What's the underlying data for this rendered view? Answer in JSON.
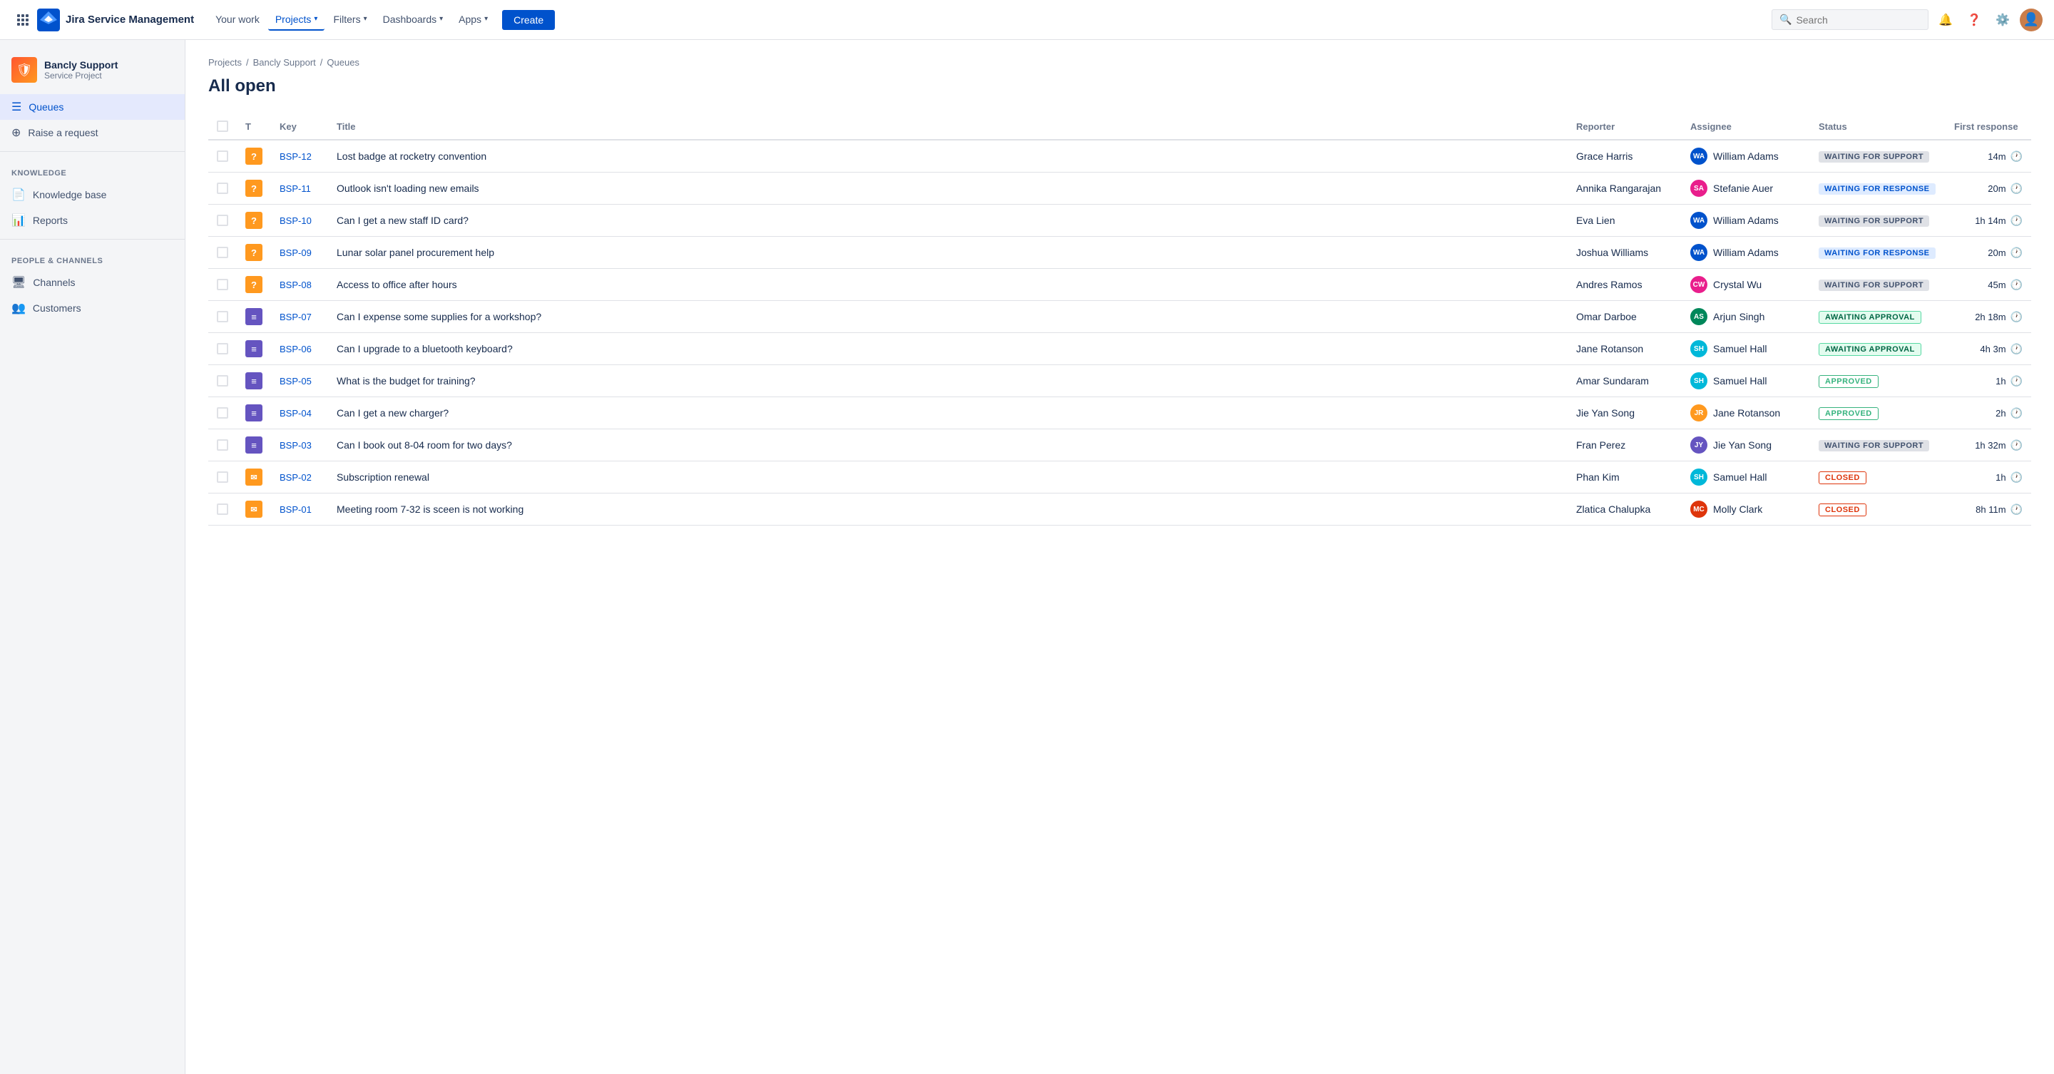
{
  "nav": {
    "logo_text": "Jira Service Management",
    "links": [
      {
        "label": "Your work",
        "active": false
      },
      {
        "label": "Projects",
        "active": true,
        "has_arrow": true
      },
      {
        "label": "Filters",
        "active": false,
        "has_arrow": true
      },
      {
        "label": "Dashboards",
        "active": false,
        "has_arrow": true
      },
      {
        "label": "Apps",
        "active": false,
        "has_arrow": true
      }
    ],
    "create_label": "Create",
    "search_placeholder": "Search"
  },
  "sidebar": {
    "project_name": "Bancly Support",
    "project_type": "Service Project",
    "nav_items": [
      {
        "label": "Queues",
        "icon": "☰",
        "active": true
      },
      {
        "label": "Raise a request",
        "icon": "⊕",
        "active": false
      }
    ],
    "knowledge_section": "KNOWLEDGE",
    "knowledge_items": [
      {
        "label": "Knowledge base",
        "icon": "📄"
      },
      {
        "label": "Reports",
        "icon": "📊"
      }
    ],
    "people_section": "PEOPLE & CHANNELS",
    "people_items": [
      {
        "label": "Channels",
        "icon": "🖥"
      },
      {
        "label": "Customers",
        "icon": "👥"
      }
    ]
  },
  "breadcrumb": [
    "Projects",
    "Bancly Support",
    "Queues"
  ],
  "page_title": "All open",
  "table": {
    "columns": [
      "",
      "T",
      "Key",
      "Title",
      "Reporter",
      "Assignee",
      "Status",
      "First response"
    ],
    "rows": [
      {
        "key": "BSP-12",
        "type": "question",
        "type_label": "?",
        "title": "Lost badge at rocketry convention",
        "reporter": "Grace Harris",
        "assignee": "William Adams",
        "assignee_initials": "WA",
        "assignee_color": "av-blue",
        "status": "WAITING FOR SUPPORT",
        "status_class": "badge-waiting-support",
        "response": "14m"
      },
      {
        "key": "BSP-11",
        "type": "question",
        "type_label": "?",
        "title": "Outlook isn't loading new emails",
        "reporter": "Annika Rangarajan",
        "assignee": "Stefanie Auer",
        "assignee_initials": "SA",
        "assignee_color": "av-pink",
        "status": "WAITING FOR RESPONSE",
        "status_class": "badge-waiting-response",
        "response": "20m"
      },
      {
        "key": "BSP-10",
        "type": "question",
        "type_label": "?",
        "title": "Can I get a new staff ID card?",
        "reporter": "Eva Lien",
        "assignee": "William Adams",
        "assignee_initials": "WA",
        "assignee_color": "av-blue",
        "status": "WAITING FOR SUPPORT",
        "status_class": "badge-waiting-support",
        "response": "1h 14m"
      },
      {
        "key": "BSP-09",
        "type": "question",
        "type_label": "?",
        "title": "Lunar solar panel procurement help",
        "reporter": "Joshua Williams",
        "assignee": "William Adams",
        "assignee_initials": "WA",
        "assignee_color": "av-blue",
        "status": "WAITING FOR RESPONSE",
        "status_class": "badge-waiting-response",
        "response": "20m"
      },
      {
        "key": "BSP-08",
        "type": "question",
        "type_label": "?",
        "title": "Access to office after hours",
        "reporter": "Andres Ramos",
        "assignee": "Crystal Wu",
        "assignee_initials": "CW",
        "assignee_color": "av-pink",
        "status": "WAITING FOR SUPPORT",
        "status_class": "badge-waiting-support",
        "response": "45m"
      },
      {
        "key": "BSP-07",
        "type": "task",
        "type_label": "≡",
        "title": "Can I expense some supplies for a workshop?",
        "reporter": "Omar Darboe",
        "assignee": "Arjun Singh",
        "assignee_initials": "AS",
        "assignee_color": "av-green",
        "status": "AWAITING APPROVAL",
        "status_class": "badge-awaiting-approval",
        "response": "2h 18m"
      },
      {
        "key": "BSP-06",
        "type": "task",
        "type_label": "≡",
        "title": "Can I upgrade to a bluetooth keyboard?",
        "reporter": "Jane Rotanson",
        "assignee": "Samuel Hall",
        "assignee_initials": "SH",
        "assignee_color": "av-teal",
        "status": "AWAITING APPROVAL",
        "status_class": "badge-awaiting-approval",
        "response": "4h 3m"
      },
      {
        "key": "BSP-05",
        "type": "task",
        "type_label": "≡",
        "title": "What is the budget for training?",
        "reporter": "Amar Sundaram",
        "assignee": "Samuel Hall",
        "assignee_initials": "SH",
        "assignee_color": "av-teal",
        "status": "APPROVED",
        "status_class": "badge-approved",
        "response": "1h"
      },
      {
        "key": "BSP-04",
        "type": "task",
        "type_label": "≡",
        "title": "Can I get a new charger?",
        "reporter": "Jie Yan Song",
        "assignee": "Jane Rotanson",
        "assignee_initials": "JR",
        "assignee_color": "av-orange",
        "status": "APPROVED",
        "status_class": "badge-approved",
        "response": "2h"
      },
      {
        "key": "BSP-03",
        "type": "task",
        "type_label": "≡",
        "title": "Can I book out 8-04 room for two days?",
        "reporter": "Fran Perez",
        "assignee": "Jie Yan Song",
        "assignee_initials": "JY",
        "assignee_color": "av-purple",
        "status": "WAITING FOR SUPPORT",
        "status_class": "badge-waiting-support",
        "response": "1h 32m"
      },
      {
        "key": "BSP-02",
        "type": "email",
        "type_label": "✉",
        "title": "Subscription renewal",
        "reporter": "Phan Kim",
        "assignee": "Samuel Hall",
        "assignee_initials": "SH",
        "assignee_color": "av-teal",
        "status": "CLOSED",
        "status_class": "badge-closed",
        "response": "1h"
      },
      {
        "key": "BSP-01",
        "type": "email",
        "type_label": "✉",
        "title": "Meeting room 7-32 is sceen is not working",
        "reporter": "Zlatica Chalupka",
        "assignee": "Molly Clark",
        "assignee_initials": "MC",
        "assignee_color": "av-red",
        "status": "CLOSED",
        "status_class": "badge-closed",
        "response": "8h 11m"
      }
    ]
  }
}
